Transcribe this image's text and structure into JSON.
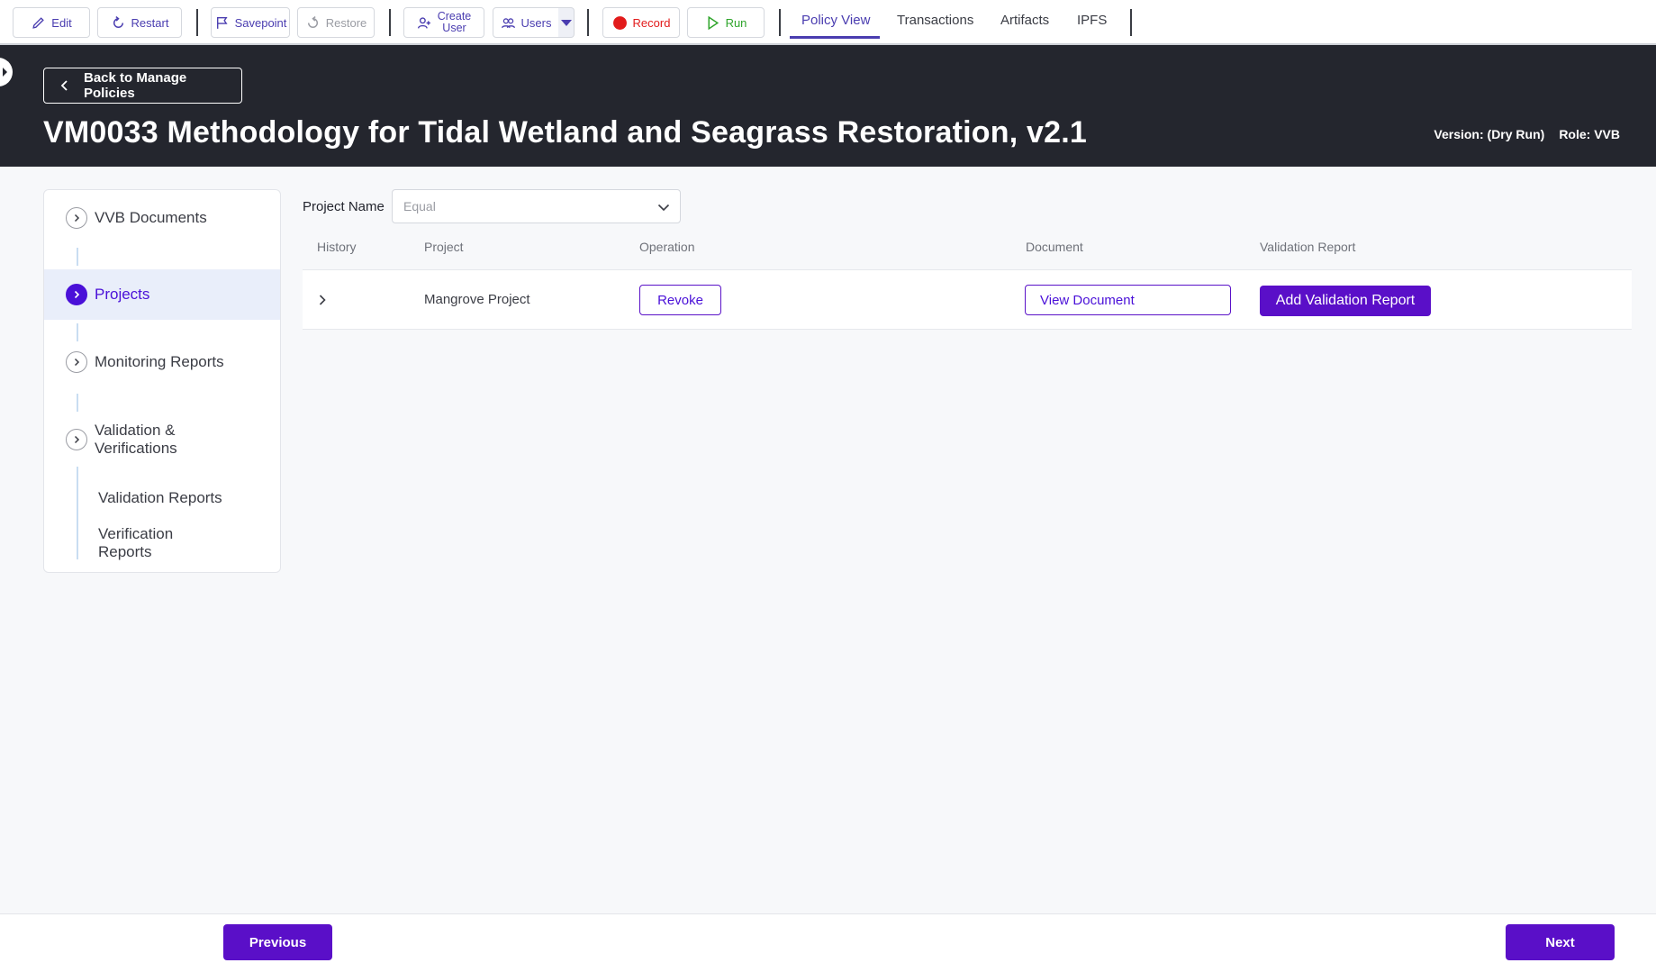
{
  "toolbar": {
    "edit": "Edit",
    "restart": "Restart",
    "savepoint": "Savepoint",
    "restore": "Restore",
    "create_user_line1": "Create",
    "create_user_line2": "User",
    "users": "Users",
    "record": "Record",
    "run": "Run",
    "tabs": [
      "Policy View",
      "Transactions",
      "Artifacts",
      "IPFS"
    ],
    "active_tab": "Policy View"
  },
  "header": {
    "back_label": "Back to Manage Policies",
    "title": "VM0033 Methodology for Tidal Wetland and Seagrass Restoration, v2.1",
    "version": "Version: (Dry Run)",
    "role": "Role: VVB"
  },
  "nav": {
    "items": [
      {
        "label": "VVB Documents",
        "active": false
      },
      {
        "label": "Projects",
        "active": true
      },
      {
        "label": "Monitoring Reports",
        "active": false
      },
      {
        "label": "Validation & Verifications",
        "active": false
      }
    ],
    "sub_items": [
      "Validation Reports",
      "Verification Reports"
    ]
  },
  "filter": {
    "label": "Project Name",
    "placeholder": "Equal"
  },
  "table": {
    "columns": [
      "History",
      "Project",
      "Operation",
      "Document",
      "Validation Report"
    ],
    "rows": [
      {
        "project": "Mangrove Project",
        "operation": "Revoke",
        "document": "View Document",
        "validation_report": "Add Validation Report"
      }
    ]
  },
  "footer": {
    "previous": "Previous",
    "next": "Next"
  },
  "colors": {
    "accent": "#5a0fc8",
    "header_bg": "#24262e",
    "record": "#e21b1b",
    "run": "#2fa52b"
  }
}
